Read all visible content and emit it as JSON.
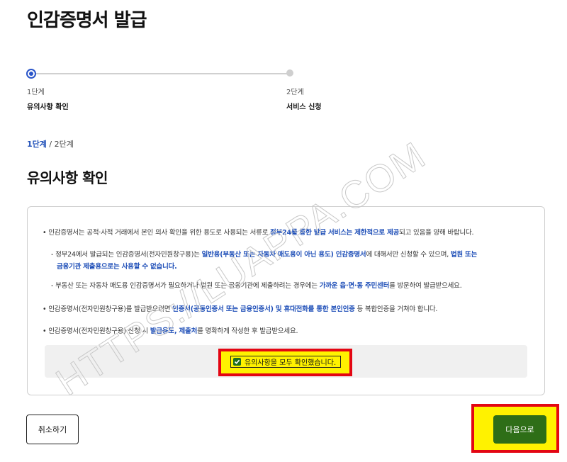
{
  "page": {
    "title": "인감증명서 발급"
  },
  "stepper": {
    "steps": [
      {
        "num": "1단계",
        "name": "유의사항 확인"
      },
      {
        "num": "2단계",
        "name": "서비스 신청"
      }
    ]
  },
  "breadcrumb": {
    "current": "1단계",
    "separator": " / ",
    "next": "2단계"
  },
  "section": {
    "title": "유의사항 확인"
  },
  "notices": [
    {
      "bullet": "• ",
      "pre": "인감증명서는 공적·사적 거래에서 본인 의사 확인을 위한 용도로 사용되는 서류로 ",
      "hl": "정부24를 통한 발급 서비스는 제한적으로 제공",
      "post": "되고 있음을 양해 바랍니다."
    },
    {
      "bullet": "- ",
      "pre": "정부24에서 발급되는 인감증명서(전자민원창구용)는 ",
      "hl": "일반용(부동산 또는 자동차 매도용이 아닌 용도) 인감증명서",
      "mid": "에 대해서만 신청할 수 있으며, ",
      "hl2": "법원 또는"
    },
    {
      "bullet": "",
      "hl": "금융기관 제출용으로는 사용할 수 없습니다."
    },
    {
      "bullet": "- ",
      "pre": "부동산 또는 자동차 매도용 인감증명서가 필요하거나 법원 또는 금융기관에 제출하려는 경우에는 ",
      "hl": "가까운 읍·면·동 주민센터",
      "post": "를 방문하여 발급받으세요."
    },
    {
      "bullet": "• ",
      "pre": "인감증명서(전자민원창구용)를 발급받으려면 ",
      "hl": "인증서(공동인증서 또는 금융인증서) 및 휴대전화를 통한 본인인증",
      "post": " 등 복합인증을 거쳐야 합니다."
    },
    {
      "bullet": "• ",
      "pre": "인감증명서(전자민원창구용) 신청 시 ",
      "hl": "발급용도, 제출처",
      "post": "를 명확하게 작성한 후 발급받으세요."
    }
  ],
  "confirm": {
    "label": "유의사항을 모두 확인했습니다."
  },
  "buttons": {
    "cancel": "취소하기",
    "next": "다음으로"
  },
  "watermark": {
    "text": "HTTPS://LUAPPA.COM"
  },
  "colors": {
    "accent": "#1f4fb8",
    "next_button": "#2e6e17",
    "highlight_border": "#e30613",
    "highlight_fill": "#fff200"
  }
}
